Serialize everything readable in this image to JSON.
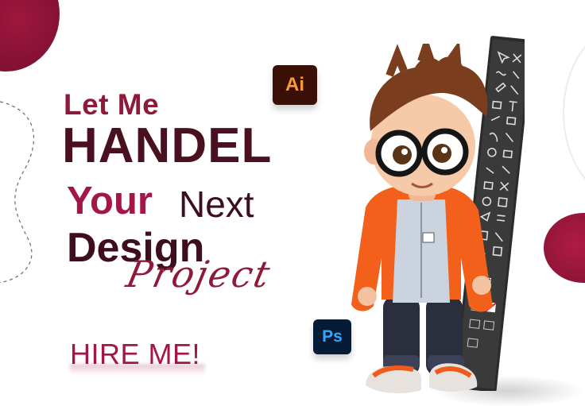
{
  "headline": {
    "line1": "Let Me",
    "line2": "HANDEL",
    "line3_bold": "Your",
    "line3_light": "Next",
    "line4": "Design",
    "line5_script": "Project"
  },
  "cta": {
    "label": "HIRE ME!"
  },
  "icons": {
    "illustrator": {
      "label": "Ai",
      "name": "adobe-illustrator-icon",
      "bg": "#3a0f06",
      "fg": "#ff9a2e"
    },
    "photoshop": {
      "label": "Ps",
      "name": "adobe-photoshop-icon",
      "bg": "#061b35",
      "fg": "#31a8ff"
    }
  },
  "colors": {
    "accent": "#a3164a",
    "dark": "#4a1020",
    "blob": "#8a1436"
  }
}
